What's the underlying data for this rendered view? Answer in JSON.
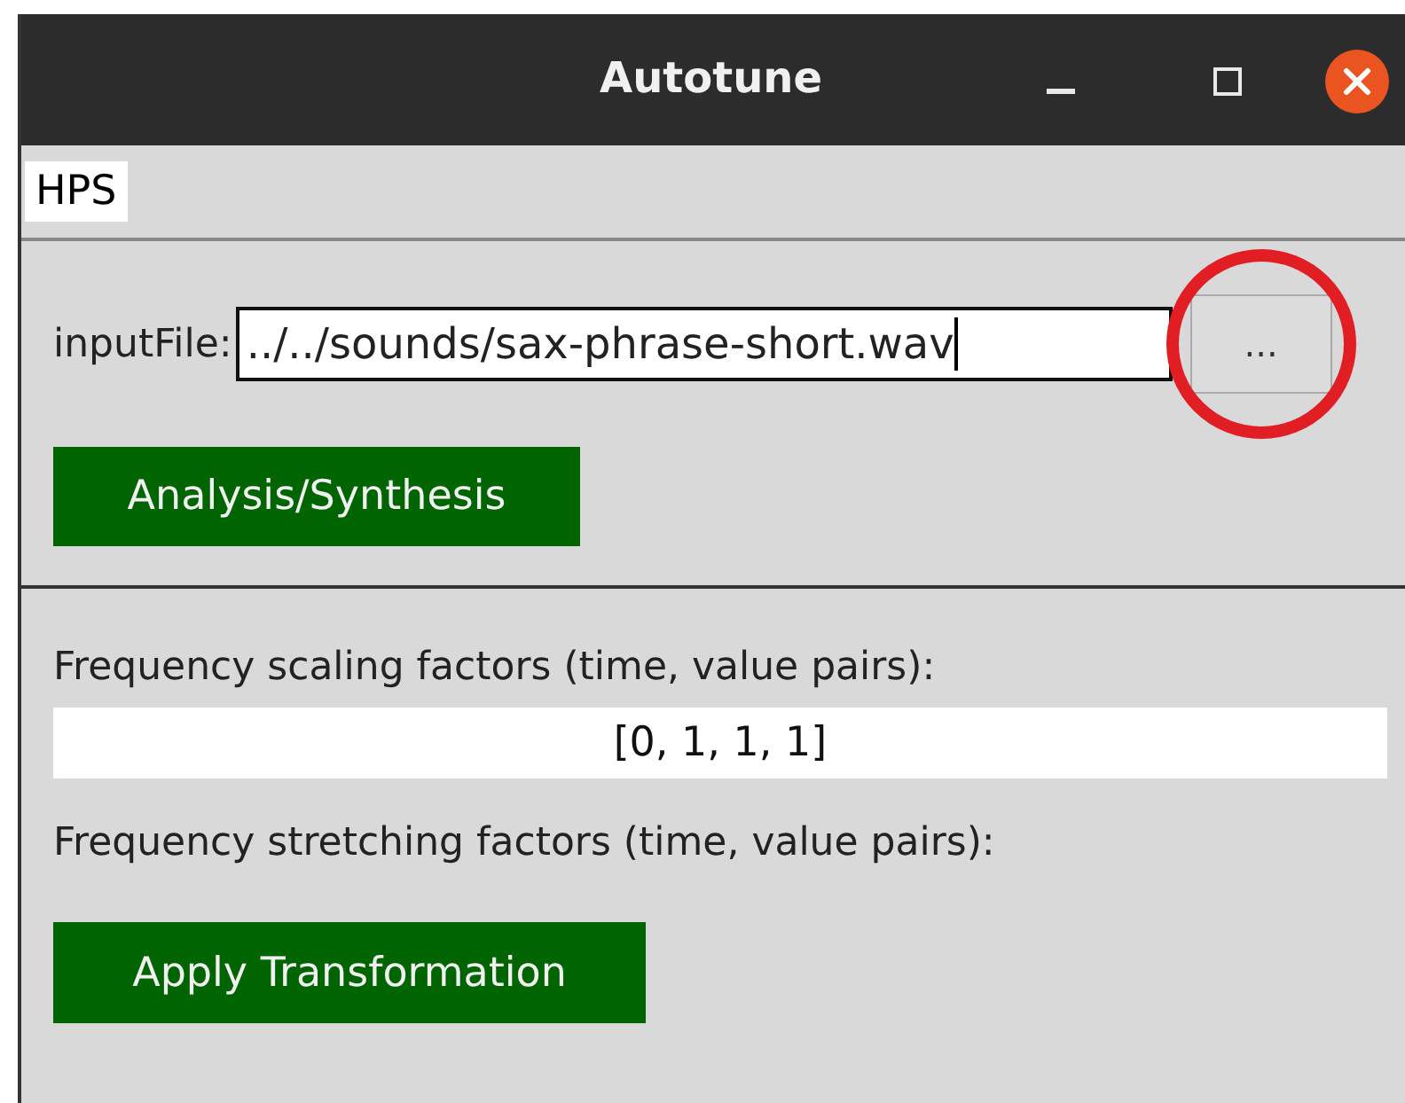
{
  "window": {
    "title": "Autotune"
  },
  "tabs": [
    {
      "label": "HPS",
      "selected": true
    }
  ],
  "input_file": {
    "label": "inputFile:",
    "value": "../../sounds/sax-phrase-short.wav",
    "browse_button": "..."
  },
  "analysis_button": "Analysis/Synthesis",
  "scaling": {
    "label": "Frequency scaling factors (time, value pairs):",
    "value": "[0, 1, 1, 1]"
  },
  "stretching": {
    "label": "Frequency stretching factors (time, value pairs):"
  },
  "apply_button": "Apply Transformation",
  "annotation": {
    "kind": "circle"
  }
}
